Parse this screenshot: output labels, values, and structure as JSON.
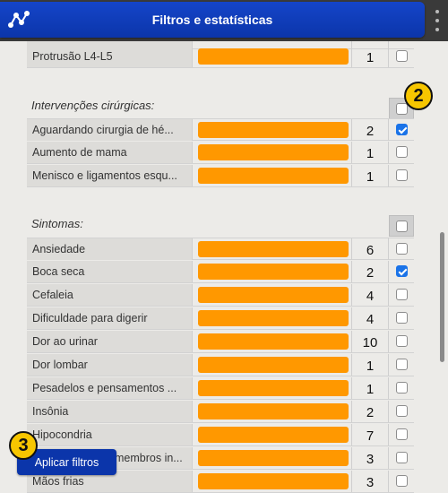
{
  "header": {
    "title": "Filtros e estatísticas",
    "logo_icon": "graph-nodes-icon",
    "menu_icon": "vertical-dots-icon",
    "bg_color": "#0b35aa"
  },
  "accent_color": "#ff9800",
  "checkbox_color": "#1a73e8",
  "sections": [
    {
      "id": "top",
      "rows": [
        {
          "label": "Protrusão L4-L5",
          "count": "1",
          "checked": false
        }
      ]
    },
    {
      "id": "cirurgias",
      "title": "Intervenções cirúrgicas:",
      "rows": [
        {
          "label": "Aguardando cirurgia de hé...",
          "count": "2",
          "checked": true
        },
        {
          "label": "Aumento de mama",
          "count": "1",
          "checked": false
        },
        {
          "label": "Menisco e ligamentos esqu...",
          "count": "1",
          "checked": false
        }
      ]
    },
    {
      "id": "sintomas",
      "title": "Sintomas:",
      "rows": [
        {
          "label": "Ansiedade",
          "count": "6",
          "checked": false
        },
        {
          "label": "Boca seca",
          "count": "2",
          "checked": true
        },
        {
          "label": "Cefaleia",
          "count": "4",
          "checked": false
        },
        {
          "label": "Dificuldade para digerir",
          "count": "4",
          "checked": false
        },
        {
          "label": "Dor ao urinar",
          "count": "10",
          "checked": false
        },
        {
          "label": "Dor lombar",
          "count": "1",
          "checked": false
        },
        {
          "label": "Pesadelos e pensamentos ...",
          "count": "1",
          "checked": false
        },
        {
          "label": "Insônia",
          "count": "2",
          "checked": false
        },
        {
          "label": "Hipocondria",
          "count": "7",
          "checked": false
        },
        {
          "label": "membros in...",
          "count": "3",
          "checked": false
        },
        {
          "label": "Mãos frias",
          "count": "3",
          "checked": false
        }
      ]
    }
  ],
  "badges": {
    "two": "2",
    "three": "3"
  },
  "apply_button": {
    "label": "Aplicar filtros"
  }
}
